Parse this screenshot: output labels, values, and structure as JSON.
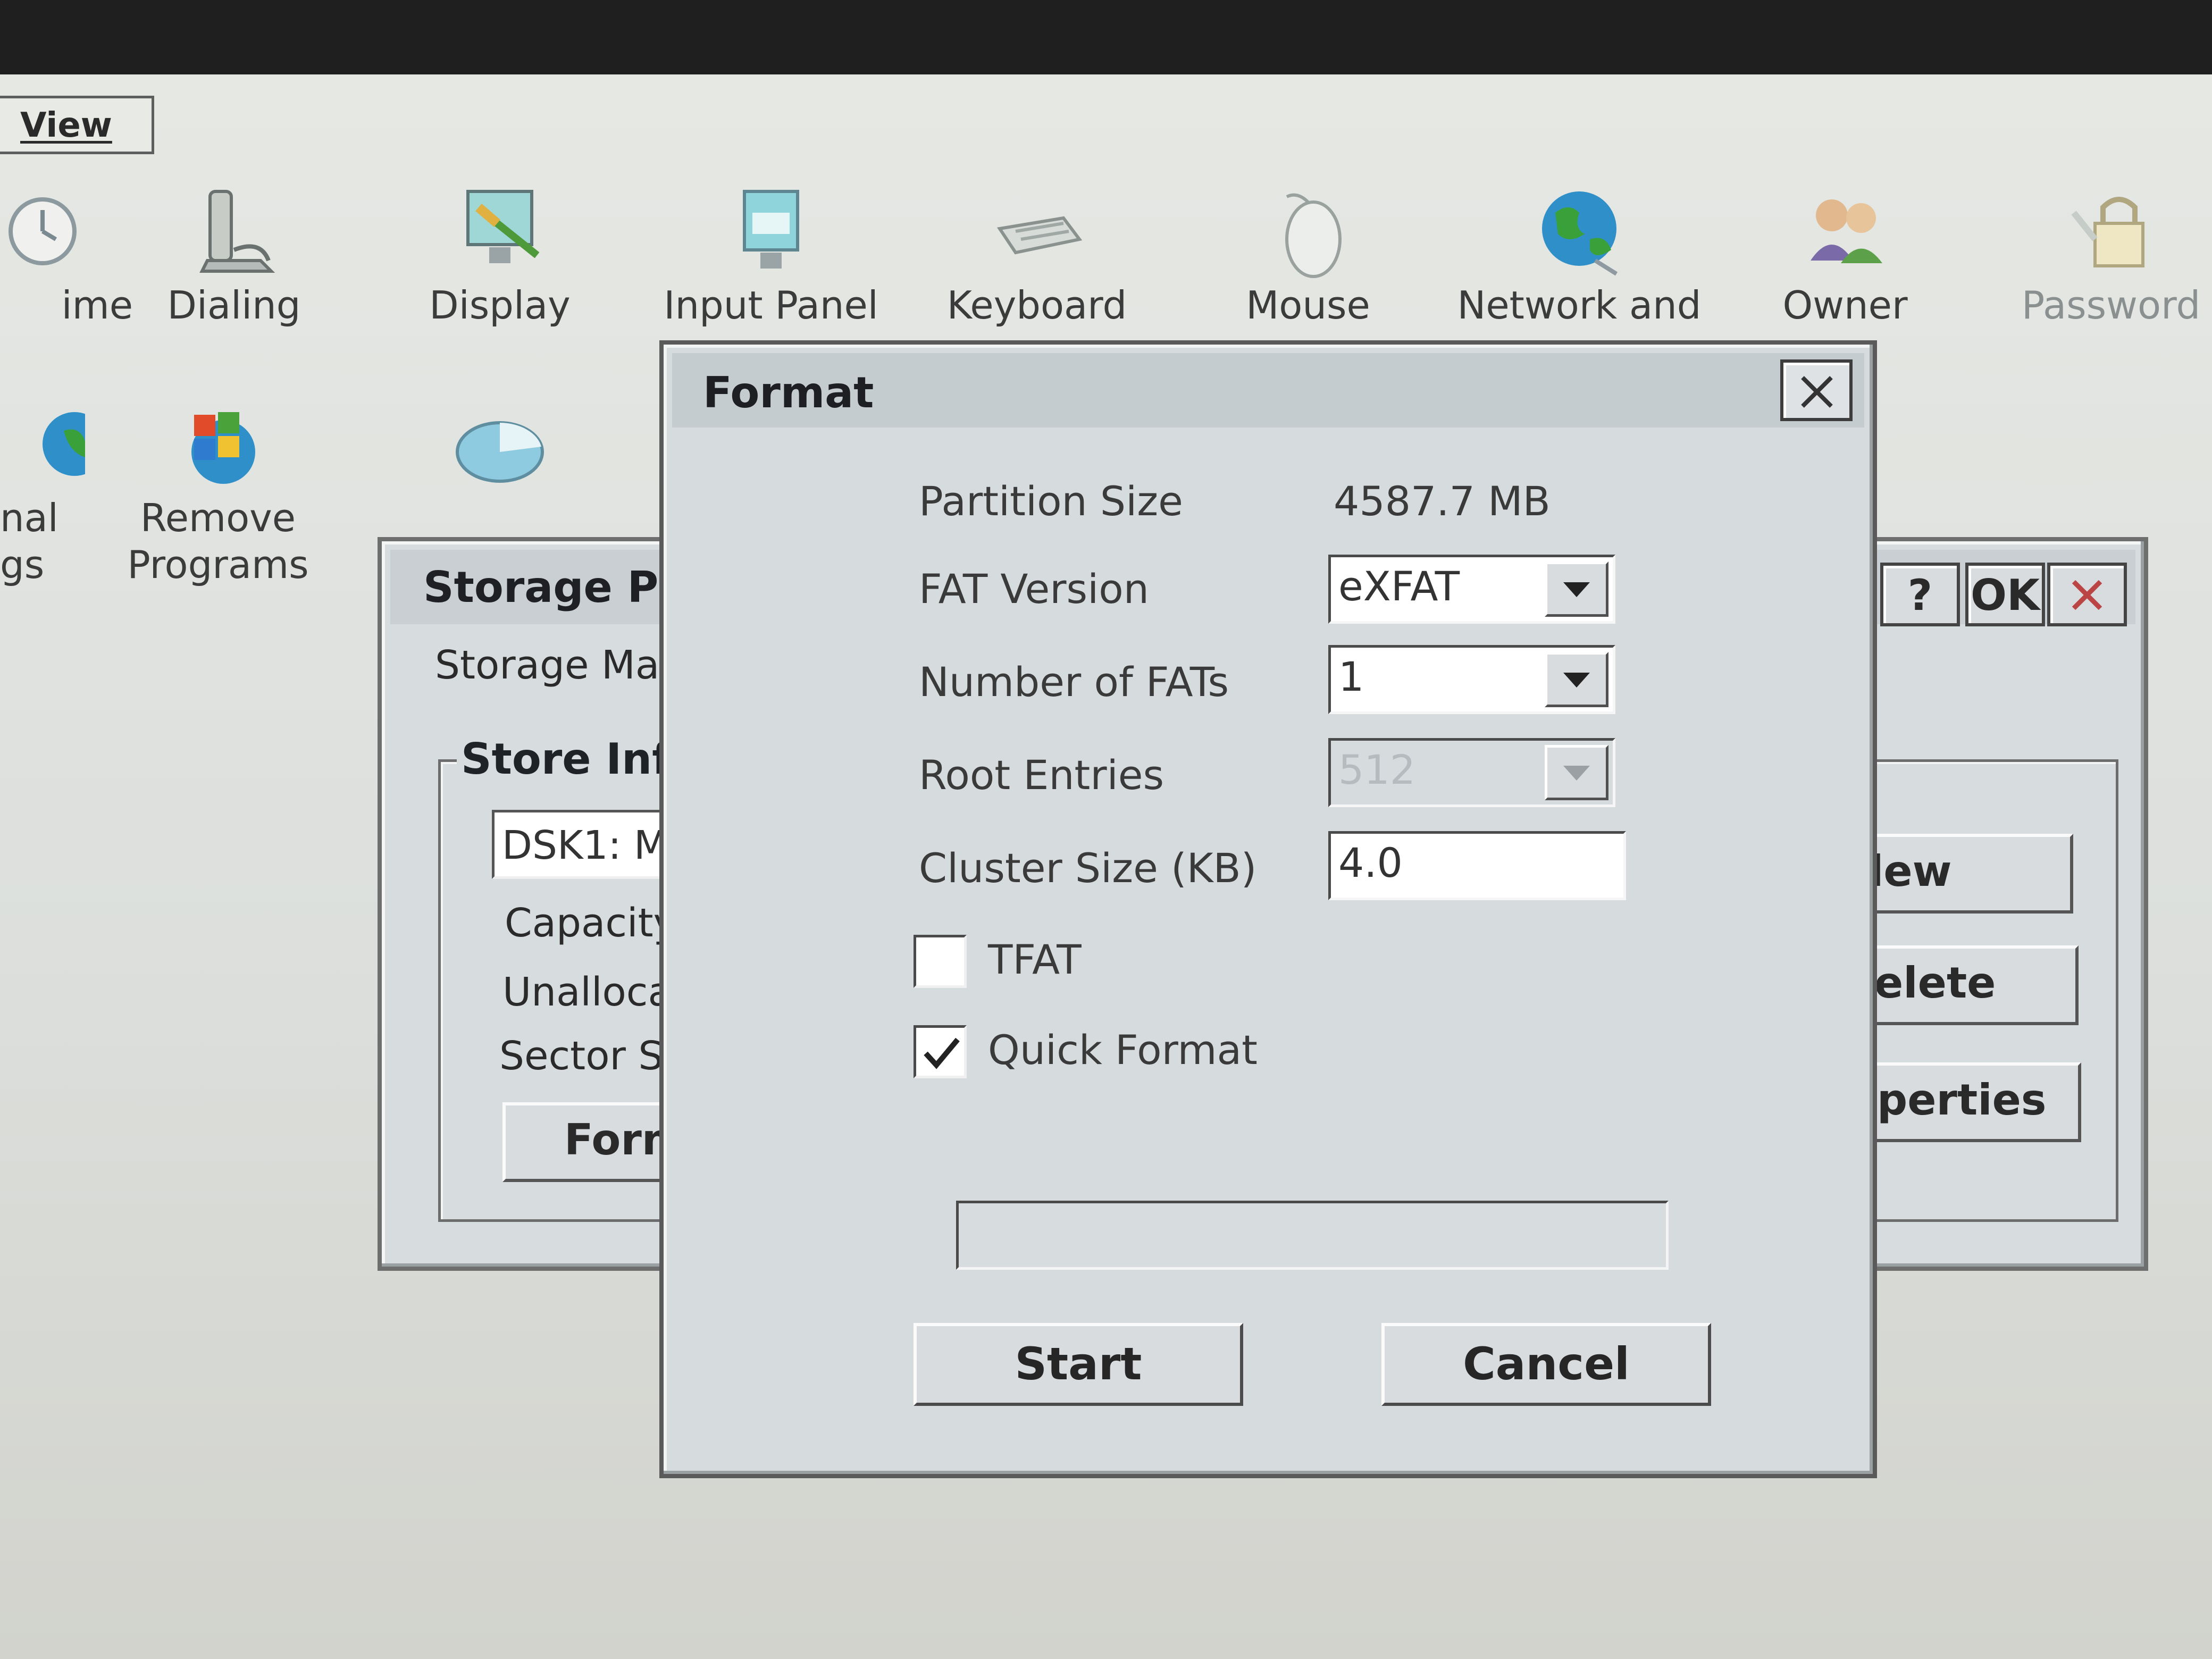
{
  "menu": {
    "view": "View"
  },
  "control_panel": {
    "row1": [
      {
        "label": "ime",
        "icon": "clock-icon"
      },
      {
        "label": "Dialing",
        "icon": "phone-icon"
      },
      {
        "label": "Display",
        "icon": "display-icon"
      },
      {
        "label": "Input Panel",
        "icon": "input-panel-icon"
      },
      {
        "label": "Keyboard",
        "icon": "keyboard-icon"
      },
      {
        "label": "Mouse",
        "icon": "mouse-icon"
      },
      {
        "label": "Network and",
        "icon": "network-globe-icon"
      },
      {
        "label": "Owner",
        "icon": "owner-icon"
      },
      {
        "label": "Password",
        "icon": "password-lock-icon"
      }
    ],
    "row2": [
      {
        "label": "nal",
        "label2": "gs",
        "icon": "regional-icon"
      },
      {
        "label": "Remove",
        "label2": "Programs",
        "icon": "remove-programs-icon"
      },
      {
        "label": "",
        "icon": "storage-manager-icon"
      }
    ]
  },
  "storage_window": {
    "title": "Storage Pro",
    "help_label": "?",
    "ok_label": "OK",
    "header_text": "Storage Man",
    "group_title": "Store Inf",
    "store_field": "DSK1: M",
    "capacity_label": "Capacity:",
    "unallocated_label": "Unallocat",
    "sector_label": "Sector S",
    "format_button": "Form",
    "new_button": "lew",
    "delete_button": "elete",
    "properties_button": "perties"
  },
  "format_dialog": {
    "title": "Format",
    "partition_size_label": "Partition Size",
    "partition_size_value": "4587.7 MB",
    "fat_version_label": "FAT Version",
    "fat_version_value": "eXFAT",
    "number_of_fats_label": "Number of FATs",
    "number_of_fats_value": "1",
    "root_entries_label": "Root Entries",
    "root_entries_value": "512",
    "cluster_size_label": "Cluster Size (KB)",
    "cluster_size_value": "4.0",
    "tfat_label": "TFAT",
    "tfat_checked": false,
    "quick_format_label": "Quick Format",
    "quick_format_checked": true,
    "progress": 0,
    "start_button": "Start",
    "cancel_button": "Cancel"
  }
}
